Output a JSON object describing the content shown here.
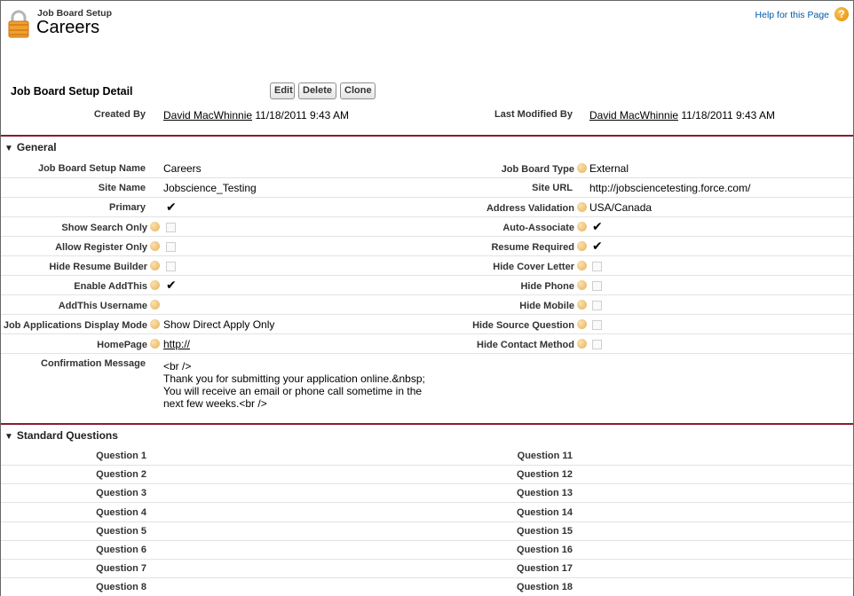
{
  "header": {
    "object_label": "Job Board Setup",
    "record_title": "Careers",
    "help_link": "Help for this Page",
    "icon": "lock-icon"
  },
  "detail": {
    "title": "Job Board Setup Detail",
    "buttons": {
      "edit": "Edit",
      "delete": "Delete",
      "clone": "Clone"
    },
    "created_by_label": "Created By",
    "created_by_user": "David MacWhinnie",
    "created_by_date": "11/18/2011 9:43 AM",
    "last_modified_label": "Last Modified By",
    "last_modified_user": "David MacWhinnie",
    "last_modified_date": "11/18/2011 9:43 AM"
  },
  "general": {
    "title": "General",
    "job_board_setup_name_label": "Job Board Setup Name",
    "job_board_setup_name": "Careers",
    "job_board_type_label": "Job Board Type",
    "job_board_type": "External",
    "site_name_label": "Site Name",
    "site_name": "Jobscience_Testing",
    "site_url_label": "Site URL",
    "site_url": "http://jobsciencetesting.force.com/",
    "primary_label": "Primary",
    "primary": true,
    "address_validation_label": "Address Validation",
    "address_validation": "USA/Canada",
    "show_search_only_label": "Show Search Only",
    "show_search_only": false,
    "auto_associate_label": "Auto-Associate",
    "auto_associate": true,
    "allow_register_only_label": "Allow Register Only",
    "allow_register_only": false,
    "resume_required_label": "Resume Required",
    "resume_required": true,
    "hide_resume_builder_label": "Hide Resume Builder",
    "hide_resume_builder": false,
    "hide_cover_letter_label": "Hide Cover Letter",
    "hide_cover_letter": false,
    "enable_addthis_label": "Enable AddThis",
    "enable_addthis": true,
    "hide_phone_label": "Hide Phone",
    "hide_phone": false,
    "addthis_username_label": "AddThis Username",
    "addthis_username": "",
    "hide_mobile_label": "Hide Mobile",
    "hide_mobile": false,
    "display_mode_label": "Job Applications Display Mode",
    "display_mode": "Show Direct Apply Only",
    "hide_source_question_label": "Hide Source Question",
    "hide_source_question": false,
    "homepage_label": "HomePage",
    "homepage": "http://",
    "hide_contact_method_label": "Hide Contact Method",
    "hide_contact_method": false,
    "confirmation_message_label": "Confirmation Message",
    "confirmation_message": "<br />\nThank you for submitting your application online.&nbsp;\nYou will receive an email or phone call sometime in the\nnext few weeks.<br />"
  },
  "standard_questions": {
    "title": "Standard Questions",
    "left": [
      "Question 1",
      "Question 2",
      "Question 3",
      "Question 4",
      "Question 5",
      "Question 6",
      "Question 7",
      "Question 8"
    ],
    "right": [
      "Question 11",
      "Question 12",
      "Question 13",
      "Question 14",
      "Question 15",
      "Question 16",
      "Question 17",
      "Question 18"
    ]
  },
  "checkmark_glyph": "✔"
}
